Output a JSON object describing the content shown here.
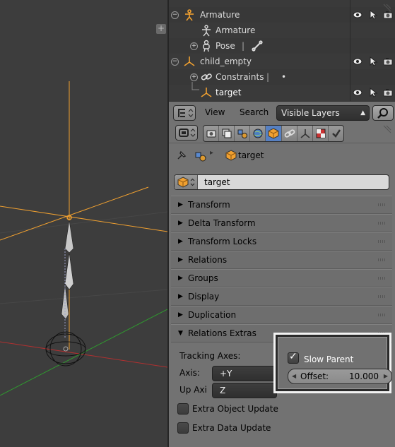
{
  "viewport": {
    "add_icon": "plus-icon"
  },
  "outliner": {
    "rows": [
      {
        "label": "Armature",
        "icon": "armature-icon",
        "expander": "−"
      },
      {
        "label": "Armature",
        "icon": "armature-data-icon"
      },
      {
        "label": "Pose",
        "icon": "pose-icon",
        "expander": "+",
        "extra": "bone-icon"
      },
      {
        "label": "child_empty",
        "icon": "empty-icon",
        "expander": "−"
      },
      {
        "label": "Constraints",
        "icon": "constraint-icon",
        "expander": "+",
        "extra": "•"
      },
      {
        "label": "target",
        "icon": "empty-icon",
        "selected": true
      }
    ],
    "restrict_icons": [
      "eye-icon",
      "cursor-icon",
      "camera-icon"
    ]
  },
  "outliner_header": {
    "view_label": "View",
    "search_label": "Search",
    "display_mode": "Visible Layers"
  },
  "properties": {
    "context_tabs": [
      "render-icon",
      "render-layers-icon",
      "scene-icon",
      "world-icon",
      "object-icon",
      "constraints-icon",
      "modifiers-icon",
      "data-icon",
      "texture-icon",
      "physics-icon"
    ],
    "active_tab": "object-icon",
    "breadcrumb": {
      "object_name": "target"
    },
    "name_field": "target",
    "panels": [
      {
        "title": "Transform",
        "expanded": false
      },
      {
        "title": "Delta Transform",
        "expanded": false
      },
      {
        "title": "Transform Locks",
        "expanded": false
      },
      {
        "title": "Relations",
        "expanded": false
      },
      {
        "title": "Groups",
        "expanded": false
      },
      {
        "title": "Display",
        "expanded": false
      },
      {
        "title": "Duplication",
        "expanded": false
      },
      {
        "title": "Relations Extras",
        "expanded": true
      }
    ],
    "relations_extras": {
      "tracking_axes_label": "Tracking Axes:",
      "axis_label": "Axis:",
      "axis_value": "+Y",
      "up_axis_label": "Up Axi",
      "up_axis_value": "Z",
      "slow_parent_label": "Slow Parent",
      "slow_parent_checked": true,
      "offset_label": "Offset:",
      "offset_value": "10.000",
      "extra_object_update_label": "Extra Object Update",
      "extra_object_update_checked": false,
      "extra_data_update_label": "Extra Data Update",
      "extra_data_update_checked": false
    }
  },
  "colors": {
    "viewport_bg": "#3d3d3d",
    "axis_x": "#b03030",
    "axis_y": "#2f9a2f",
    "selected_orange": "#f0a030",
    "active_tab": "#5680c2"
  }
}
